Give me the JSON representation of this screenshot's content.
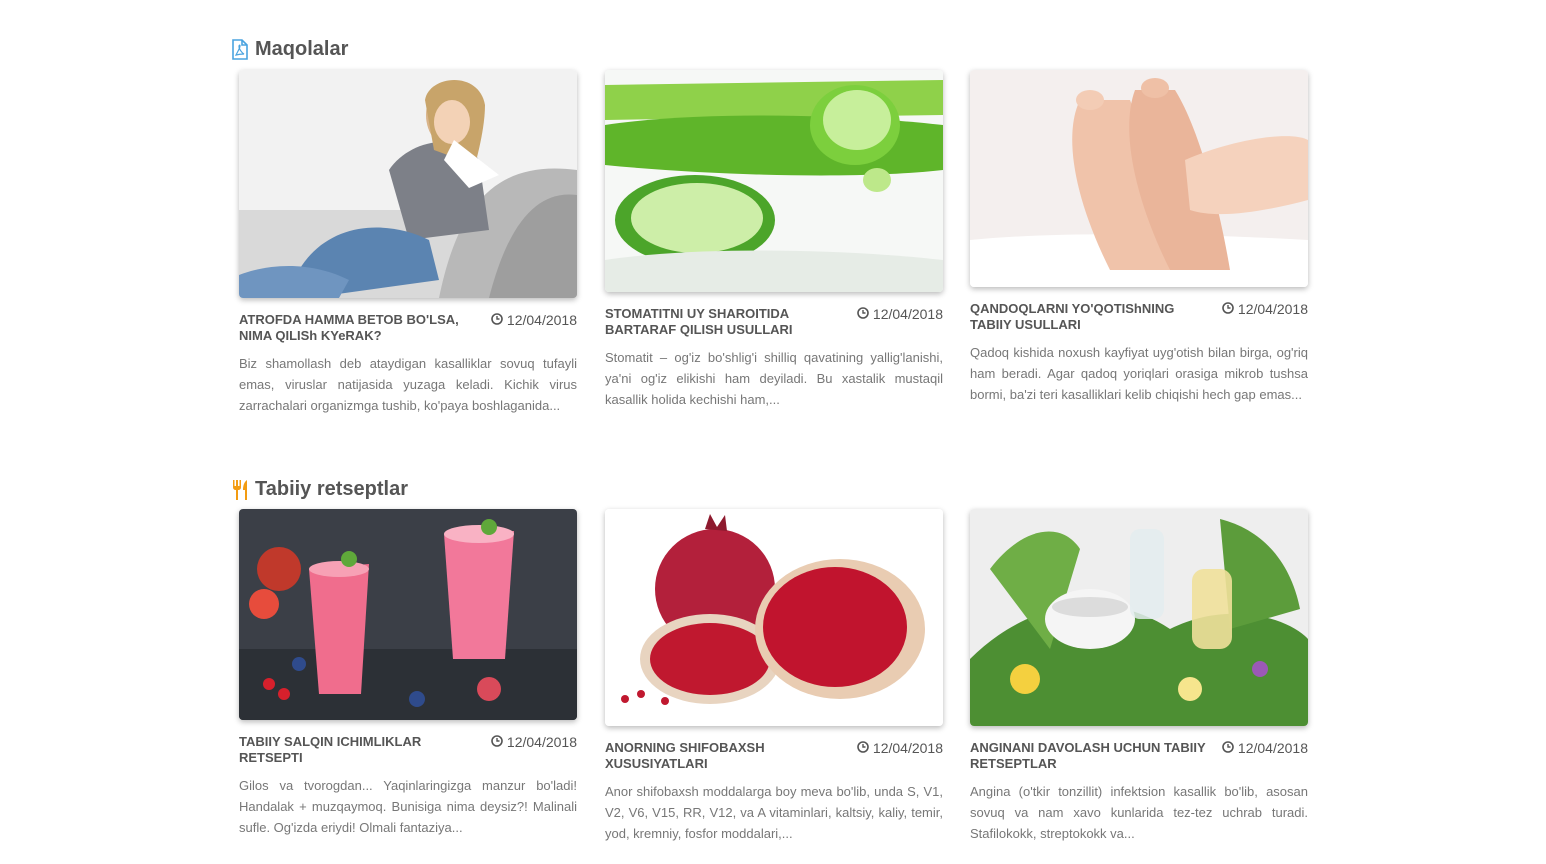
{
  "sections": [
    {
      "title": "Maqolalar",
      "icon": "pdf-file-icon",
      "icon_color": "#4aa3df",
      "cards": [
        {
          "title": "ATROFDA HAMMA BETOB BO'LSA, NIMA QILISh KYeRAK?",
          "date": "12/04/2018",
          "excerpt": "Biz shamollash deb ataydigan kasalliklar sovuq tufayli emas, viruslar natijasida yuzaga keladi. Kichik virus zarrachalari organizmga tushib, ko'paya boshlaganida...",
          "image": "woman-with-cold-photo"
        },
        {
          "title": "STOMATITNI UY SHAROITIDA BARTARAF QILISH USULLARI",
          "date": "12/04/2018",
          "excerpt": "Stomatit – og'iz bo'shlig'i shilliq qavatining yallig'lanishi, ya'ni og'iz elikishi ham deyiladi. Bu xastalik mustaqil kasallik holida kechishi ham,...",
          "image": "aloe-vera-photo"
        },
        {
          "title": "QANDOQLARNI YO'QOTIShNING TABIIY USULLARI",
          "date": "12/04/2018",
          "excerpt": "Qadoq kishida noxush kayfiyat uyg'otish bilan birga, og'riq ham beradi. Agar qadoq yoriqlari orasiga mikrob tushsa bormi, ba'zi teri kasalliklari kelib chiqishi hech gap emas...",
          "image": "feet-massage-photo"
        }
      ]
    },
    {
      "title": "Tabiiy retseptlar",
      "icon": "fork-knife-icon",
      "icon_color": "#f39c12",
      "cards": [
        {
          "title": "TABIIY SALQIN ICHIMLIKLAR RETSEPTI",
          "date": "12/04/2018",
          "excerpt": "Gilos va tvorogdan... Yaqinlaringizga manzur bo'ladi! Handalak + muzqaymoq. Bunisiga nima deysiz?! Malinali sufle. Og'izda eriydi! Olmali fantaziya...",
          "image": "berry-smoothie-photo"
        },
        {
          "title": "ANORNING SHIFOBAXSH XUSUSIYATLARI",
          "date": "12/04/2018",
          "excerpt": "Anor shifobaxsh moddalarga boy meva bo'lib, unda S, V1, V2, V6, V15, RR, V12, va A vitaminlari, kaltsiy, kaliy, temir, yod, kremniy, fosfor moddalari,...",
          "image": "pomegranate-photo"
        },
        {
          "title": "ANGINANI DAVOLASH UCHUN TABIIY RETSEPTLAR",
          "date": "12/04/2018",
          "excerpt": "Angina (o'tkir tonzillit) infektsion kasallik bo'lib, asosan sovuq va nam xavo kunlarida tez-tez uchrab turadi. Stafilokokk, streptokokk va...",
          "image": "herbs-mortar-photo"
        }
      ]
    }
  ]
}
